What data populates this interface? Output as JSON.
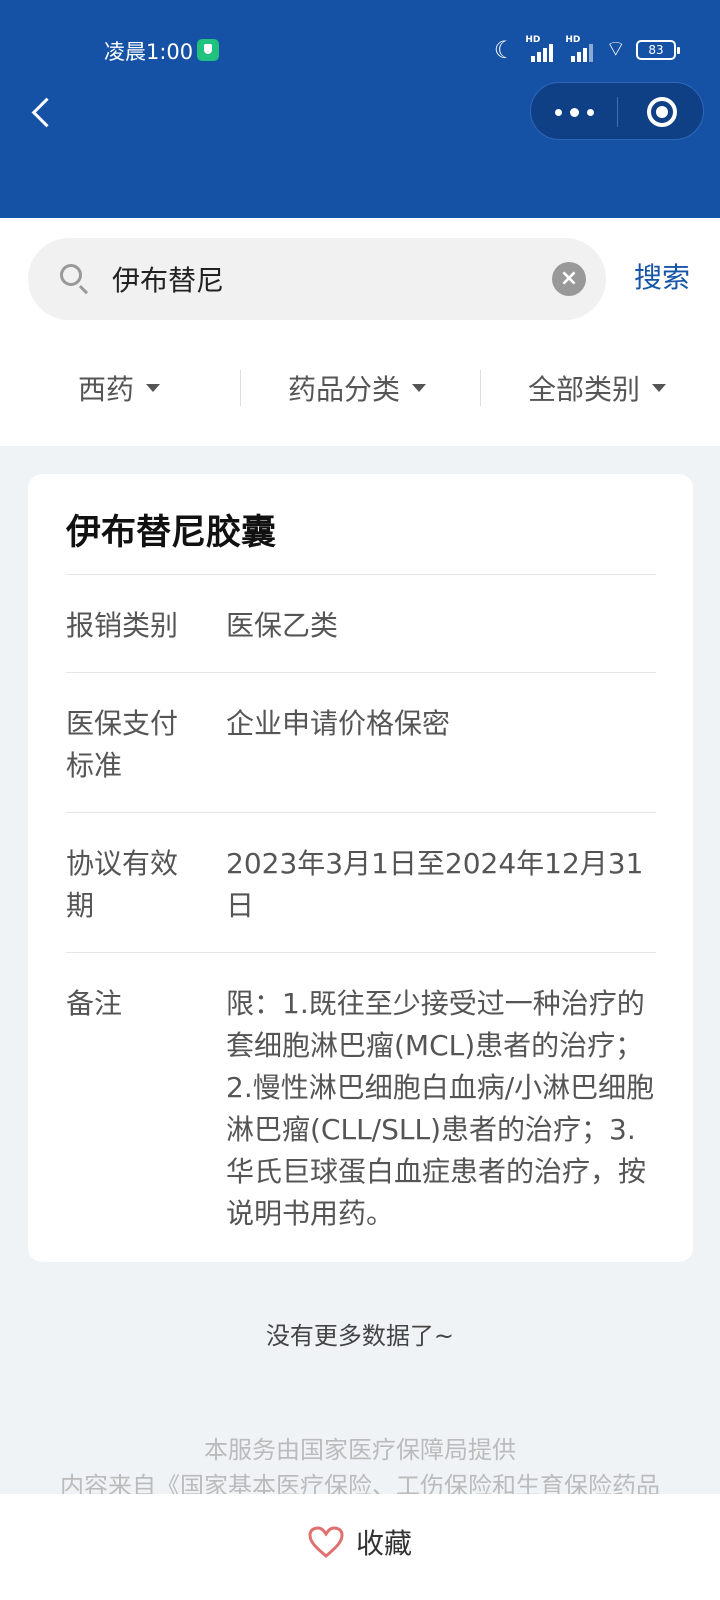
{
  "status_bar": {
    "time": "凌晨1:00",
    "battery": "83",
    "network_1": "HD",
    "network_2": "HD"
  },
  "search": {
    "value": "伊布替尼",
    "button": "搜索"
  },
  "filters": [
    {
      "label": "西药"
    },
    {
      "label": "药品分类"
    },
    {
      "label": "全部类别"
    }
  ],
  "drug": {
    "name": "伊布替尼胶囊",
    "rows": [
      {
        "label": "报销类别",
        "value": "医保乙类"
      },
      {
        "label": "医保支付标准",
        "value": "企业申请价格保密"
      },
      {
        "label": "协议有效期",
        "value": "2023年3月1日至2024年12月31日"
      },
      {
        "label": "备注",
        "value": "限：1.既往至少接受过一种治疗的套细胞淋巴瘤(MCL)患者的治疗；2.慢性淋巴细胞白血病/小淋巴细胞淋巴瘤(CLL/SLL)患者的治疗；3.华氏巨球蛋白血症患者的治疗，按说明书用药。"
      }
    ]
  },
  "list_end": "没有更多数据了~",
  "footer": {
    "line1": "本服务由国家医疗保障局提供",
    "line2": "内容来自《国家基本医疗保险、工伤保险和生育保险药品"
  },
  "bottom": {
    "favorite": "收藏"
  },
  "colors": {
    "header_bg": "#1552a6",
    "accent": "#1755a8",
    "page_bg": "#eff3f6",
    "heart": "#e07070"
  }
}
